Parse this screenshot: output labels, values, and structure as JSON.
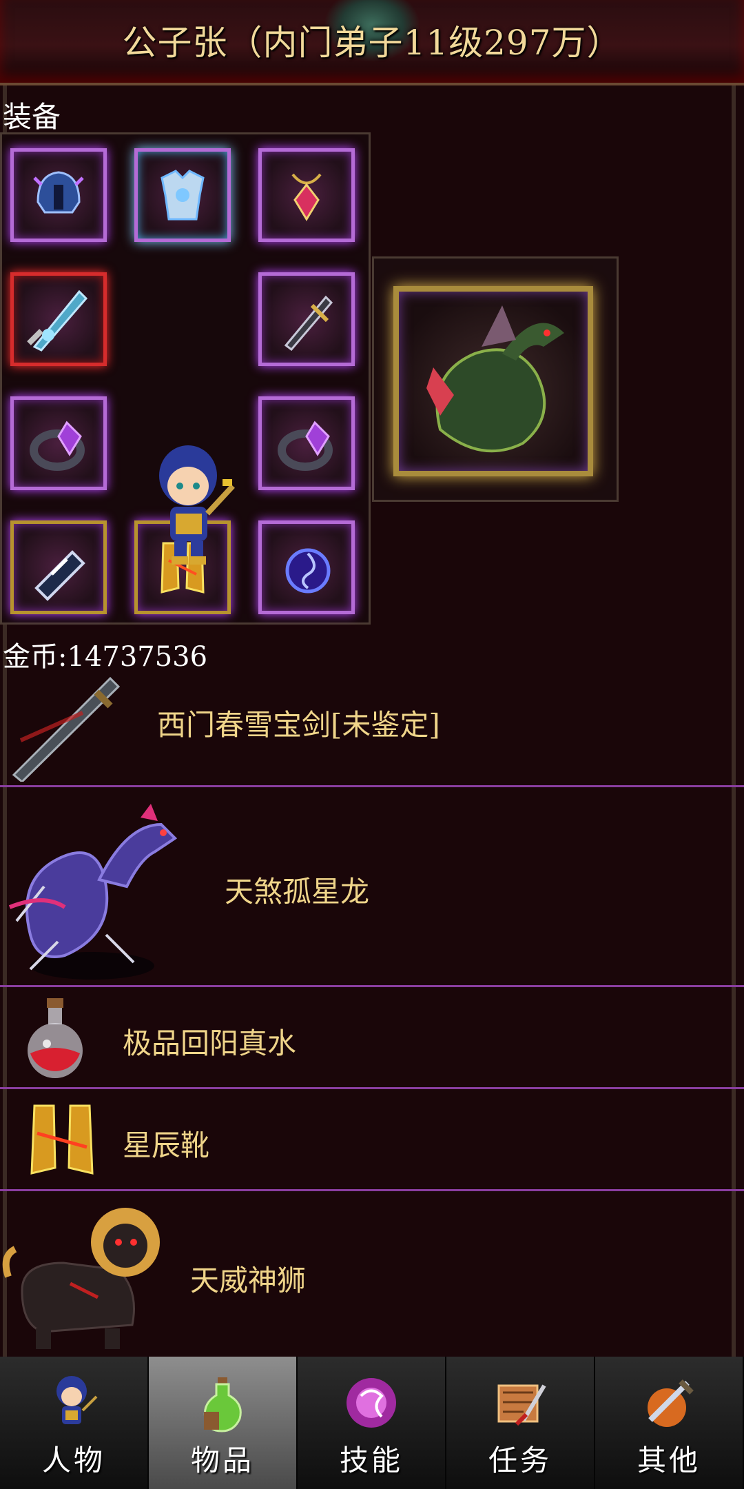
{
  "header": {
    "title": "公子张（内门弟子11级297万）"
  },
  "equipment": {
    "label": "装备",
    "slots": [
      {
        "name": "helmet-icon"
      },
      {
        "name": "armor-icon"
      },
      {
        "name": "amulet-icon"
      },
      {
        "name": "sword-icon"
      },
      {
        "name": "dagger-icon"
      },
      {
        "name": "ring-icon"
      },
      {
        "name": "ring-icon"
      },
      {
        "name": "bracer-icon"
      },
      {
        "name": "boots-icon"
      },
      {
        "name": "orb-icon"
      }
    ],
    "mount_icon": "dragon-mount-icon"
  },
  "inventory": {
    "gold_label": "金币:14737536",
    "items": [
      {
        "name": "西门春雪宝剑[未鉴定]",
        "icon": "sword-icon"
      },
      {
        "name": "天煞孤星龙",
        "icon": "dragon-icon"
      },
      {
        "name": "极品回阳真水",
        "icon": "potion-icon"
      },
      {
        "name": "星辰靴",
        "icon": "boots-icon"
      },
      {
        "name": "天威神狮",
        "icon": "lion-icon"
      }
    ]
  },
  "nav": {
    "tabs": [
      {
        "label": "人物",
        "icon": "character-icon",
        "active": false
      },
      {
        "label": "物品",
        "icon": "items-icon",
        "active": true
      },
      {
        "label": "技能",
        "icon": "skills-icon",
        "active": false
      },
      {
        "label": "任务",
        "icon": "quests-icon",
        "active": false
      },
      {
        "label": "其他",
        "icon": "other-icon",
        "active": false
      }
    ]
  },
  "colors": {
    "background": "#1a0609",
    "title_text": "#f2d99a",
    "item_text": "#f0d58a",
    "divider": "#8a3ea0",
    "active_tab": "#8e8e8e"
  }
}
